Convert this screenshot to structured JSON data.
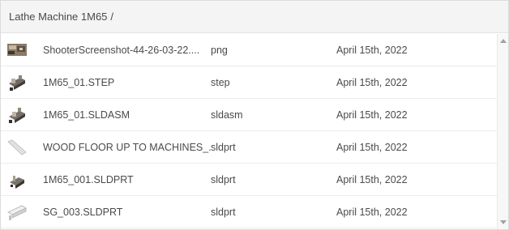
{
  "breadcrumb": {
    "label": "Lathe Machine 1M65",
    "separator": "/"
  },
  "files": [
    {
      "name": "ShooterScreenshot-44-26-03-22....",
      "type": "png",
      "date": "April 15th, 2022",
      "icon": "photo-thumbnail-icon"
    },
    {
      "name": "1M65_01.STEP",
      "type": "step",
      "date": "April 15th, 2022",
      "icon": "machine-model-thumbnail-icon"
    },
    {
      "name": "1M65_01.SLDASM",
      "type": "sldasm",
      "date": "April 15th, 2022",
      "icon": "machine-model-thumbnail-icon"
    },
    {
      "name": "WOOD FLOOR UP TO MACHINES_...",
      "type": "sldprt",
      "date": "April 15th, 2022",
      "icon": "floor-panel-thumbnail-icon"
    },
    {
      "name": "1M65_001.SLDPRT",
      "type": "sldprt",
      "date": "April 15th, 2022",
      "icon": "machine-part-thumbnail-icon"
    },
    {
      "name": "SG_003.SLDPRT",
      "type": "sldprt",
      "date": "April 15th, 2022",
      "icon": "rail-part-thumbnail-icon"
    }
  ],
  "colors": {
    "header_bg": "#f4f4f4",
    "row_divider": "#ececec",
    "text": "#4a4a4a"
  }
}
